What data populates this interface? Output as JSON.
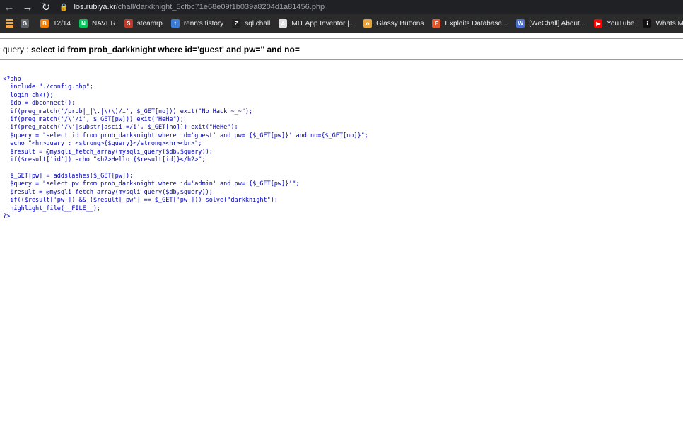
{
  "browser": {
    "url_host": "los.rubiya.kr",
    "url_path": "/chall/darkknight_5cfbc71e68e09f1b039a8204d1a81456.php"
  },
  "bookmarks": [
    {
      "label": "",
      "icon": "globe-icon",
      "color": "#5f6368"
    },
    {
      "label": "12/14",
      "icon": "blogger-icon",
      "color": "#f57d00"
    },
    {
      "label": "NAVER",
      "icon": "naver-icon",
      "color": "#03c75a"
    },
    {
      "label": "steamrp",
      "icon": "steam-icon",
      "color": "#c0392b"
    },
    {
      "label": "renn's tistory",
      "icon": "tistory-icon",
      "color": "#3b7dd8"
    },
    {
      "label": "sql chall",
      "icon": "z-icon",
      "color": "#222222"
    },
    {
      "label": "MIT App Inventor |...",
      "icon": "app-inventor-icon",
      "color": "#e0e0e0"
    },
    {
      "label": "Glassy Buttons",
      "icon": "glassy-icon",
      "color": "#e8a33d"
    },
    {
      "label": "Exploits Database...",
      "icon": "exploitdb-icon",
      "color": "#e4572e"
    },
    {
      "label": "[WeChall] About...",
      "icon": "wechall-icon",
      "color": "#4a6fd1"
    },
    {
      "label": "YouTube",
      "icon": "youtube-icon",
      "color": "#ff0000"
    },
    {
      "label": "Whats My IP A",
      "icon": "ip-icon",
      "color": "#111111"
    }
  ],
  "query": {
    "prefix": "query : ",
    "sql": "select id from prob_darkknight where id='guest' and pw='' and no="
  },
  "source_lines": [
    "<?php",
    "  include \"./config.php\";",
    "  login_chk();",
    "  $db = dbconnect();",
    "  if(preg_match('/prob|_|\\.|\\(\\)/i', $_GET[no])) exit(\"No Hack ~_~\");",
    "  if(preg_match('/\\'/i', $_GET[pw])) exit(\"HeHe\");",
    "  if(preg_match('/\\'|substr|ascii|=/i', $_GET[no])) exit(\"HeHe\");",
    "  $query = \"select id from prob_darkknight where id='guest' and pw='{$_GET[pw]}' and no={$_GET[no]}\";",
    "  echo \"<hr>query : <strong>{$query}</strong><hr><br>\";",
    "  $result = @mysqli_fetch_array(mysqli_query($db,$query));",
    "  if($result['id']) echo \"<h2>Hello {$result[id]}</h2>\";",
    "",
    "  $_GET[pw] = addslashes($_GET[pw]);",
    "  $query = \"select pw from prob_darkknight where id='admin' and pw='{$_GET[pw]}'\";",
    "  $result = @mysqli_fetch_array(mysqli_query($db,$query));",
    "  if(($result['pw']) && ($result['pw'] == $_GET['pw'])) solve(\"darkknight\");",
    "  highlight_file(__FILE__);",
    "?>"
  ]
}
